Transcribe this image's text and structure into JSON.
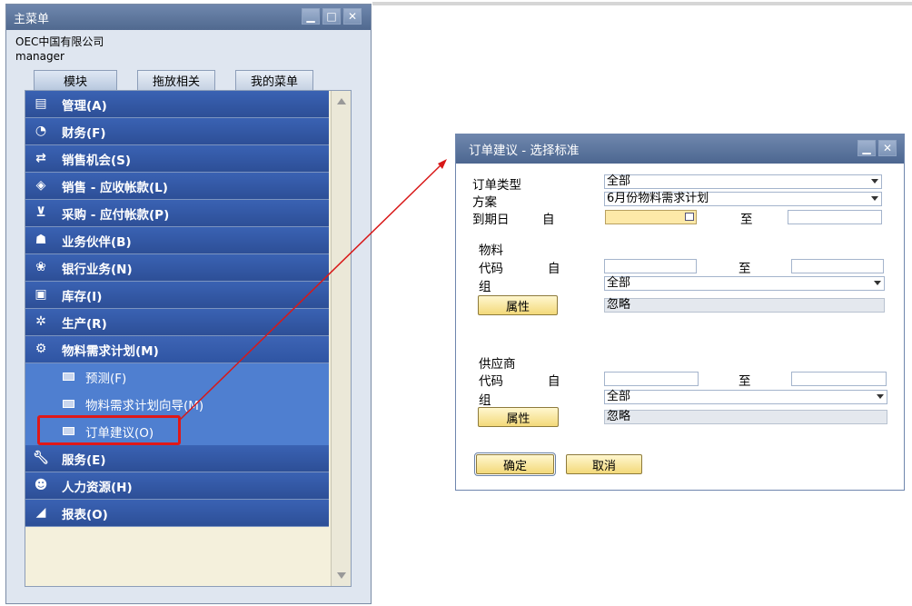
{
  "main_menu": {
    "title": "主菜单",
    "company": "OEC中国有限公司",
    "user": "manager",
    "tabs": [
      "模块",
      "拖放相关",
      "我的菜单"
    ],
    "items": [
      {
        "label": "管理(A)",
        "icon": "admin-icon"
      },
      {
        "label": "财务(F)",
        "icon": "finance-icon"
      },
      {
        "label": "销售机会(S)",
        "icon": "opportunity-icon"
      },
      {
        "label": "销售 - 应收帐款(L)",
        "icon": "sales-tag-icon"
      },
      {
        "label": "采购 - 应付帐款(P)",
        "icon": "cart-icon"
      },
      {
        "label": "业务伙伴(B)",
        "icon": "partner-icon"
      },
      {
        "label": "银行业务(N)",
        "icon": "bank-icon"
      },
      {
        "label": "库存(I)",
        "icon": "inventory-icon"
      },
      {
        "label": "生产(R)",
        "icon": "gear-icon"
      },
      {
        "label": "物料需求计划(M)",
        "icon": "mrp-icon"
      }
    ],
    "sub_items": [
      {
        "label": "预测(F)"
      },
      {
        "label": "物料需求计划向导(M)"
      },
      {
        "label": "订单建议(O)"
      }
    ],
    "items_after": [
      {
        "label": "服务(E)",
        "icon": "wrench-icon"
      },
      {
        "label": "人力资源(H)",
        "icon": "people-icon"
      },
      {
        "label": "报表(O)",
        "icon": "report-icon"
      }
    ]
  },
  "dialog": {
    "title": "订单建议 - 选择标准",
    "order_type_label": "订单类型",
    "order_type_value": "全部",
    "scenario_label": "方案",
    "scenario_value": "6月份物料需求计划",
    "due_date_label": "到期日",
    "from_label": "自",
    "to_label": "至",
    "item_section": "物料",
    "code_label": "代码",
    "group_label": "组",
    "item_group_value": "全部",
    "properties_button": "属性",
    "ignore_value": "忽略",
    "vendor_section": "供应商",
    "vendor_group_value": "全部",
    "ok_button": "确定",
    "cancel_button": "取消"
  },
  "colors": {
    "menu_item_bg": "#2d4f97",
    "submenu_bg": "#4f7fd0",
    "highlight_box": "#e01818",
    "titlebar": "#50698f",
    "button_yellow": "#f3d97a"
  }
}
